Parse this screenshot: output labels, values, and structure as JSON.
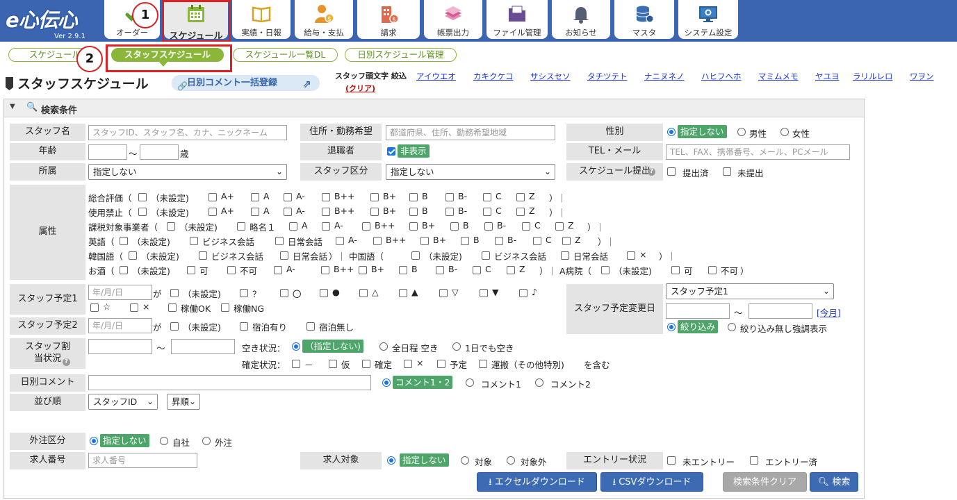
{
  "app": {
    "logo": "e心伝心",
    "version": "Ver 2.9.1"
  },
  "nav": [
    {
      "label": "オーダー",
      "icon": "order-icon"
    },
    {
      "label": "スケジュール",
      "icon": "calendar-icon"
    },
    {
      "label": "実績・日報",
      "icon": "book-icon"
    },
    {
      "label": "給与・支払",
      "icon": "payroll-icon"
    },
    {
      "label": "請求",
      "icon": "building-invoice-icon"
    },
    {
      "label": "帳票出力",
      "icon": "forms-icon"
    },
    {
      "label": "ファイル管理",
      "icon": "folder-icon"
    },
    {
      "label": "お知らせ",
      "icon": "bell-icon"
    },
    {
      "label": "マスタ",
      "icon": "database-icon"
    },
    {
      "label": "システム設定",
      "icon": "monitor-settings-icon"
    }
  ],
  "steps": [
    "1",
    "2"
  ],
  "subtabs": [
    "スケジュール",
    "スタッフスケジュール",
    "スケジュール一覧DL",
    "日別スケジュール管理"
  ],
  "page": {
    "title": "スタッフスケジュール",
    "bulk_comment": "日別コメント一括登録"
  },
  "kana": {
    "label": "スタッフ頭文字 絞込",
    "clear": "(クリア)",
    "rows": [
      "アイウエオ",
      "カキクケコ",
      "サシスセソ",
      "タチツテト",
      "ナニヌネノ",
      "ハヒフヘホ",
      "マミムメモ",
      "ヤユヨ",
      "ラリルレロ",
      "ワヲン"
    ]
  },
  "panel": {
    "title": "検索条件"
  },
  "form": {
    "staff_name": {
      "label": "スタッフ名",
      "placeholder": "スタッフID、スタッフ名、カナ、ニックネーム"
    },
    "address": {
      "label": "住所・勤務希望",
      "placeholder": "都道府県、住所、勤務希望地域"
    },
    "gender": {
      "label": "性別",
      "options": [
        "指定しない",
        "男性",
        "女性"
      ]
    },
    "age": {
      "label": "年齢",
      "sep": "～",
      "unit": "歳"
    },
    "retired": {
      "label": "退職者",
      "option": "非表示"
    },
    "tel": {
      "label": "TEL・メール",
      "placeholder": "TEL、FAX、携帯番号、メール、PCメール"
    },
    "affiliation": {
      "label": "所属",
      "value": "指定しない"
    },
    "staff_type": {
      "label": "スタッフ区分",
      "value": "指定しない"
    },
    "submit": {
      "label": "スケジュール提出",
      "options": [
        "提出済",
        "未提出"
      ]
    },
    "attributes": {
      "label": "属性",
      "rows": [
        {
          "head": "総合評価（",
          "items": [
            "（未設定)",
            "A+",
            "A",
            "A-",
            "B++",
            "B+",
            "B",
            "B-",
            "C",
            "Z"
          ],
          "tail": "）｜"
        },
        {
          "head": "使用禁止（",
          "items": [
            "（未設定)",
            "A+",
            "A",
            "A-",
            "B++",
            "B+",
            "B",
            "B-",
            "C",
            "Z"
          ],
          "tail": "）｜"
        },
        {
          "head": "課税対象事業者（",
          "items": [
            "（未設定)",
            "略名１",
            "A",
            "A-",
            "B++",
            "B+",
            "B",
            "B-",
            "C",
            "Z"
          ],
          "tail": "）｜"
        },
        {
          "head": "英語（",
          "items": [
            "（未設定)",
            "ビジネス会話",
            "日常会話",
            "A-",
            "B++",
            "B+",
            "B",
            "B-",
            "C",
            "Z"
          ],
          "tail": "）｜"
        },
        {
          "head": "韓国語（",
          "items": [
            "（未設定)",
            "ビジネス会話",
            "日常会話"
          ],
          "mid": "）｜ 中国語（",
          "items2": [
            "（未設定)",
            "ビジネス会話",
            "日常会話",
            "×"
          ],
          "tail": "）｜"
        },
        {
          "head": "お酒（",
          "items": [
            "（未設定)",
            "可",
            "不可",
            "A-",
            "B++",
            "B+",
            "B",
            "B-",
            "C",
            "Z"
          ],
          "mid": "）｜ A病院（",
          "items2": [
            "（未設定)",
            "可",
            "不可"
          ],
          "tail": "）"
        }
      ]
    },
    "plan1": {
      "label": "スタッフ予定1",
      "placeholder": "年/月/日",
      "ga": "が",
      "options": [
        "（未設定)",
        "？",
        "〇",
        "●",
        "△",
        "▲",
        "▽",
        "▼",
        "♪",
        "☆",
        "×",
        "稼働OK",
        "稼働NG"
      ]
    },
    "plan2": {
      "label": "スタッフ予定2",
      "placeholder": "年/月/日",
      "ga": "が",
      "options": [
        "（未設定)",
        "宿泊有り",
        "宿泊無し"
      ]
    },
    "plan_change": {
      "label": "スタッフ予定変更日",
      "select": "スタッフ予定1",
      "sep": "～",
      "this_month": "[今月]",
      "options": [
        "絞り込み",
        "絞り込み無し強調表示"
      ]
    },
    "assign": {
      "label": "スタッフ割当状況",
      "sep": "～",
      "vacancy_label": "空き状況：",
      "vacancy_options": [
        "（指定しない)",
        "全日程 空き",
        "1日でも空き"
      ],
      "confirm_label": "確定状況：",
      "confirm_options": [
        "－",
        "仮",
        "確定",
        "×",
        "予定",
        "運搬（その他特別)"
      ],
      "suffix": "を含む"
    },
    "daily_comment": {
      "label": "日別コメント",
      "options": [
        "コメント1・2",
        "コメント1",
        "コメント2"
      ]
    },
    "sort": {
      "label": "並び順",
      "field": "スタッフID",
      "order": "昇順"
    },
    "outsource": {
      "label": "外注区分",
      "options": [
        "指定しない",
        "自社",
        "外注"
      ]
    },
    "job_no": {
      "label": "求人番号",
      "placeholder": "求人番号"
    },
    "job_target": {
      "label": "求人対象",
      "options": [
        "指定しない",
        "対象",
        "対象外"
      ]
    },
    "entry": {
      "label": "エントリー状況",
      "options": [
        "未エントリー",
        "エントリー済"
      ]
    }
  },
  "buttons": {
    "excel": "エクセルダウンロード",
    "csv": "CSVダウンロード",
    "clear": "検索条件クリア",
    "search": "検索"
  },
  "colors": {
    "header": "#3b65b1",
    "green": "#8ab63a",
    "pill": "#4ea56a",
    "blue_button": "#3c6bb3",
    "highlight": "#e02020"
  }
}
